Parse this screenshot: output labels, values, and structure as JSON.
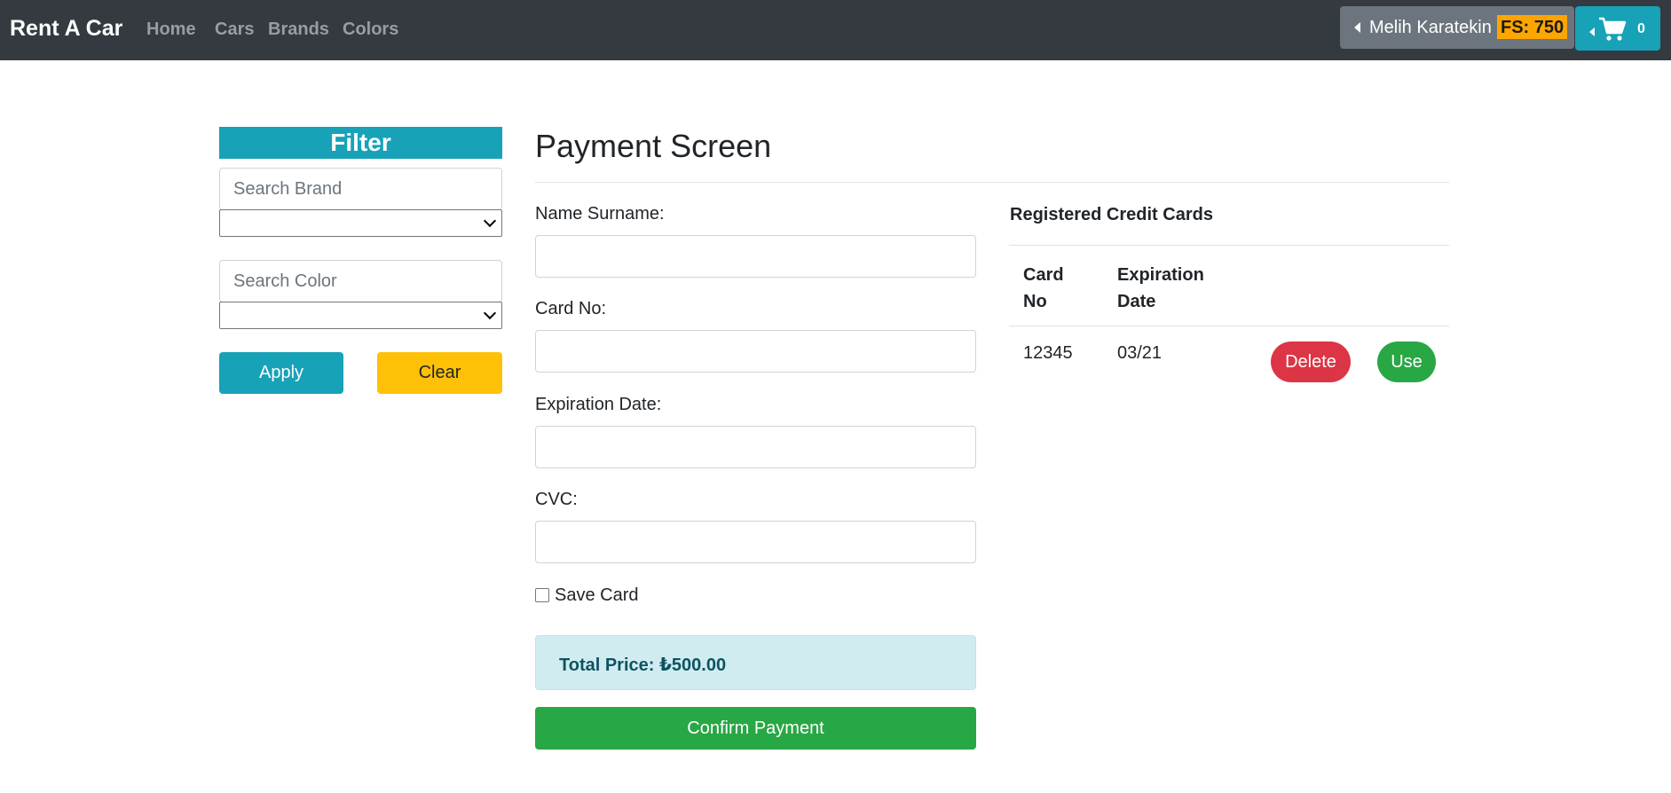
{
  "navbar": {
    "brand": "Rent A Car",
    "links": [
      "Home",
      "Cars",
      "Brands",
      "Colors"
    ],
    "user_name": "Melih Karatekin",
    "fs_label": "FS: 750",
    "cart_count": "0"
  },
  "filter": {
    "title": "Filter",
    "brand_placeholder": "Search Brand",
    "color_placeholder": "Search Color",
    "apply_label": "Apply",
    "clear_label": "Clear"
  },
  "payment": {
    "title": "Payment Screen",
    "name_label": "Name Surname:",
    "card_no_label": "Card No:",
    "expiration_label": "Expiration Date:",
    "cvc_label": "CVC:",
    "save_card_label": "Save Card",
    "total_label": "Total Price: ₺500.00",
    "confirm_label": "Confirm Payment"
  },
  "cards": {
    "title": "Registered Credit Cards",
    "headers": [
      "Card No",
      "Expiration Date"
    ],
    "rows": [
      {
        "card_no": "12345",
        "expiration": "03/21",
        "delete_label": "Delete",
        "use_label": "Use"
      }
    ]
  },
  "colors": {
    "navbar": "#343a40",
    "info": "#17a2b8",
    "warning": "#ffc107",
    "success": "#28a745",
    "danger": "#dc3545",
    "fs_badge": "#ffa500"
  }
}
